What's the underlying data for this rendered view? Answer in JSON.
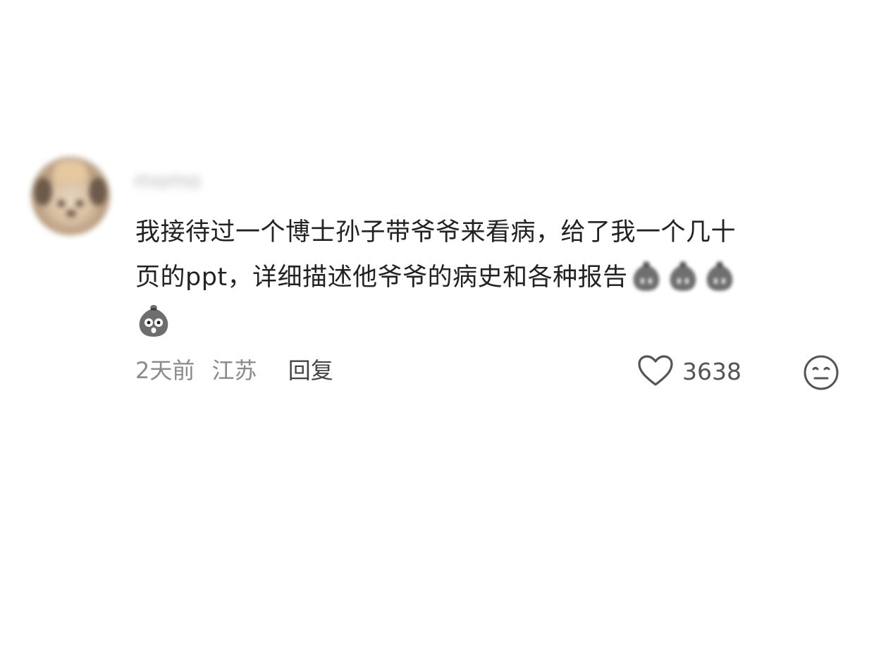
{
  "comment": {
    "username": "momo",
    "text_lines": [
      "我接待过一个博士孙子带爷爷来看病，给了我一个几十",
      "页的ppt，详细描述他爷爷的病史和各种报告"
    ],
    "emojis": [
      "sack-emoji",
      "sack-emoji",
      "sack-emoji",
      "shocked-sack-emoji"
    ],
    "time": "2天前",
    "region": "江苏",
    "reply_label": "回复",
    "like_count": "3638"
  },
  "icons": {
    "like": "heart-icon",
    "reaction": "neutral-face-icon"
  },
  "colors": {
    "text": "#222222",
    "meta": "#8a8a8a",
    "reply": "#444444",
    "icon": "#555555"
  }
}
